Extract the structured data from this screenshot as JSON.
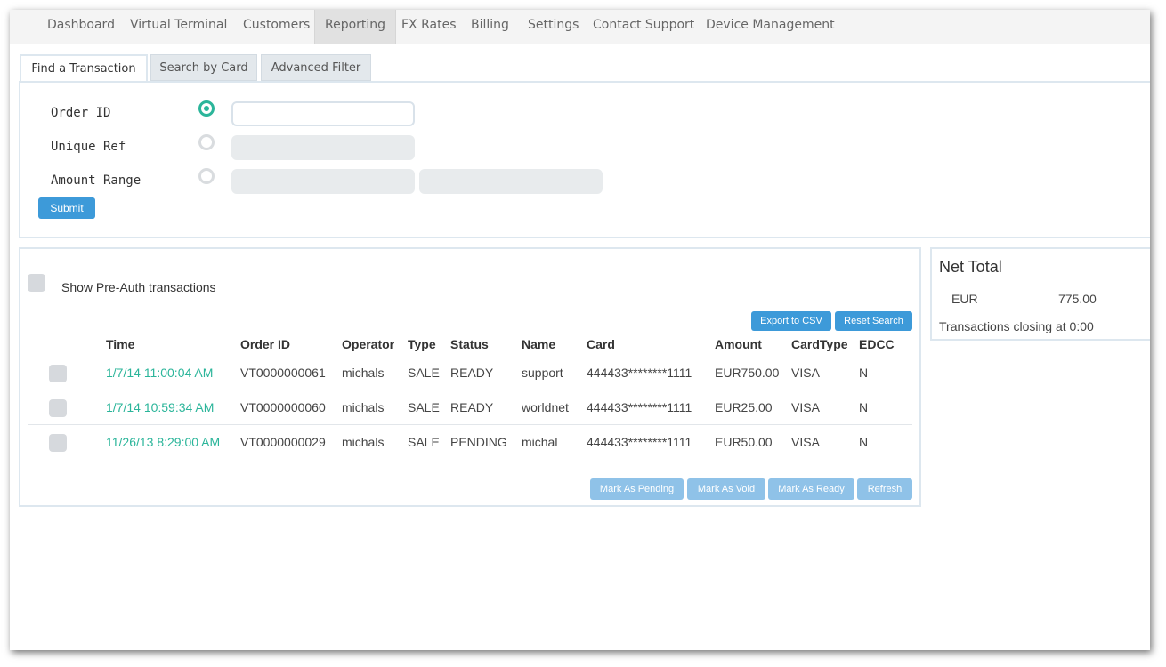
{
  "nav": {
    "items": [
      "Dashboard",
      "Virtual Terminal",
      "Customers",
      "Reporting",
      "FX Rates",
      "Billing",
      "Settings",
      "Contact Support",
      "Device Management"
    ],
    "active": "Reporting"
  },
  "search": {
    "tabs": [
      "Find a Transaction",
      "Search by Card",
      "Advanced Filter"
    ],
    "fields": {
      "order_id_label": "Order ID",
      "unique_ref_label": "Unique Ref",
      "amount_range_label": "Amount Range"
    },
    "order_id_value": "",
    "submit_label": "Submit"
  },
  "transactions": {
    "show_preauth_label": "Show Pre-Auth transactions",
    "export_label": "Export to CSV",
    "reset_label": "Reset Search",
    "columns": [
      "Time",
      "Order ID",
      "Operator",
      "Type",
      "Status",
      "Name",
      "Card",
      "Amount",
      "CardType",
      "EDCC"
    ],
    "rows": [
      {
        "time": "1/7/14 11:00:04 AM",
        "order_id": "VT0000000061",
        "operator": "michals",
        "type": "SALE",
        "status": "READY",
        "name": "support",
        "card": "444433********1111",
        "amount": "EUR750.00",
        "cardtype": "VISA",
        "edcc": "N"
      },
      {
        "time": "1/7/14 10:59:34 AM",
        "order_id": "VT0000000060",
        "operator": "michals",
        "type": "SALE",
        "status": "READY",
        "name": "worldnet",
        "card": "444433********1111",
        "amount": "EUR25.00",
        "cardtype": "VISA",
        "edcc": "N"
      },
      {
        "time": "11/26/13 8:29:00 AM",
        "order_id": "VT0000000029",
        "operator": "michals",
        "type": "SALE",
        "status": "PENDING",
        "name": "michal",
        "card": "444433********1111",
        "amount": "EUR50.00",
        "cardtype": "VISA",
        "edcc": "N"
      }
    ],
    "actions": [
      "Mark As Pending",
      "Mark As Void",
      "Mark As Ready",
      "Refresh"
    ]
  },
  "net_total": {
    "title": "Net Total",
    "currency": "EUR",
    "amount": "775.00",
    "closing_text": "Transactions closing at 0:00"
  },
  "colors": {
    "accent": "#2bb59a",
    "button": "#3d9ad9",
    "button_disabled": "#8fc2e8"
  }
}
